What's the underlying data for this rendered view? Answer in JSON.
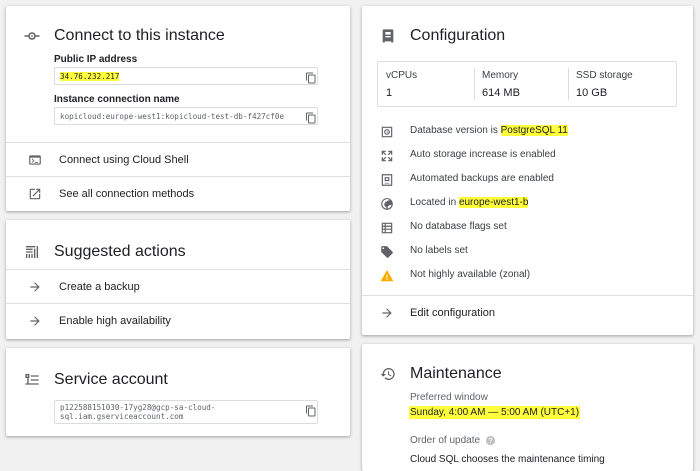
{
  "connect": {
    "title": "Connect to this instance",
    "public_ip_label": "Public IP address",
    "public_ip_value": "34.76.232.217",
    "conn_name_label": "Instance connection name",
    "conn_name_value": "kopicloud:europe-west1:kopicloud-test-db-f427cf0e",
    "actions": [
      {
        "label": "Connect using Cloud Shell",
        "icon": "terminal-icon"
      },
      {
        "label": "See all connection methods",
        "icon": "open-in-new-icon"
      }
    ]
  },
  "suggested": {
    "title": "Suggested actions",
    "actions": [
      {
        "label": "Create a backup",
        "icon": "arrow-right-icon"
      },
      {
        "label": "Enable high availability",
        "icon": "arrow-right-icon"
      }
    ]
  },
  "service": {
    "title": "Service account",
    "value_line1": "p122588151030-17yg28@gcp-sa-cloud-",
    "value_line2": "sql.iam.gserviceaccount.com"
  },
  "config": {
    "title": "Configuration",
    "stats": [
      {
        "label": "vCPUs",
        "value": "1"
      },
      {
        "label": "Memory",
        "value": "614 MB"
      },
      {
        "label": "SSD storage",
        "value": "10 GB"
      }
    ],
    "items": [
      {
        "prefix": "Database version is ",
        "highlight": "PostgreSQL 11",
        "icon": "database-version-icon"
      },
      {
        "prefix": "Auto storage increase is enabled",
        "highlight": "",
        "icon": "expand-icon"
      },
      {
        "prefix": "Automated backups are enabled",
        "highlight": "",
        "icon": "backup-icon"
      },
      {
        "prefix": "Located in ",
        "highlight": "europe-west1-b",
        "icon": "globe-icon"
      },
      {
        "prefix": "No database flags set",
        "highlight": "",
        "icon": "table-icon"
      },
      {
        "prefix": "No labels set",
        "highlight": "",
        "icon": "label-icon"
      },
      {
        "prefix": "Not highly available (zonal)",
        "highlight": "",
        "icon": "warning-icon"
      }
    ],
    "edit_label": "Edit configuration"
  },
  "maintenance": {
    "title": "Maintenance",
    "window_label": "Preferred window",
    "window_value": "Sunday, 4:00 AM — 5:00 AM (UTC+1)",
    "order_label": "Order of update",
    "order_value": "Cloud SQL chooses the maintenance timing"
  },
  "colors": {
    "highlight": "#ffff3b",
    "warning": "#f9ab00",
    "icon": "#5f6368"
  }
}
